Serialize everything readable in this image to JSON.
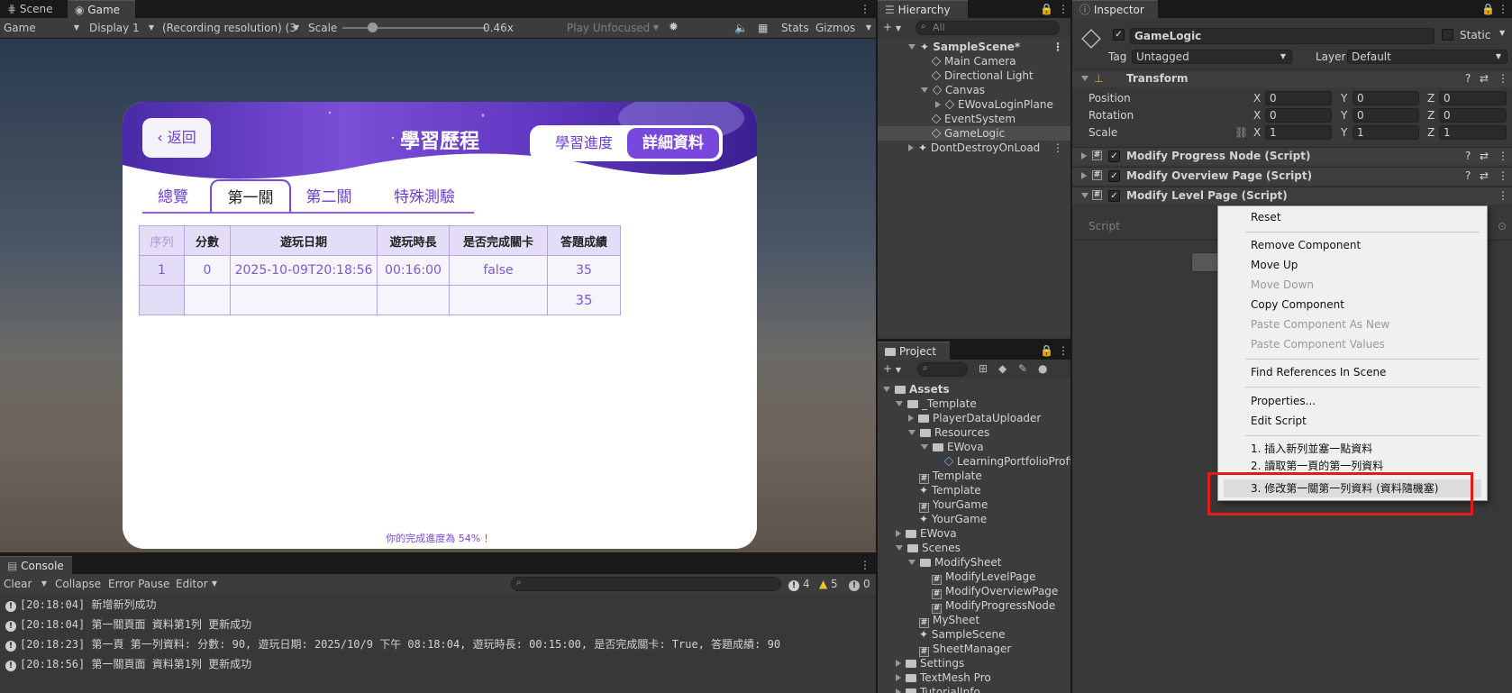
{
  "scene_panel": {
    "tabs": [
      {
        "label": "Scene"
      },
      {
        "label": "Game"
      }
    ],
    "toolbar": {
      "view_mode": "Game",
      "display": "Display 1",
      "resolution": "(Recording resolution) (3",
      "scale_label": "Scale",
      "scale_value": "0.46x",
      "play_mode": "Play Unfocused",
      "stats": "Stats",
      "gizmos": "Gizmos"
    }
  },
  "game": {
    "back_label": "返回",
    "title": "學習歷程",
    "segments": [
      "學習進度",
      "詳細資料"
    ],
    "level_tabs": [
      "總覽",
      "第一關",
      "第二關",
      "特殊測驗"
    ],
    "table": {
      "headers": [
        "序列",
        "分數",
        "遊玩日期",
        "遊玩時長",
        "是否完成關卡",
        "答題成績"
      ],
      "rows": [
        [
          "1",
          "0",
          "2025-10-09T20:18:56",
          "00:16:00",
          "false",
          "35"
        ],
        [
          "",
          "",
          "",
          "",
          "",
          "35"
        ]
      ]
    },
    "progress_note": "你的完成進度為 54% ！"
  },
  "hierarchy": {
    "tab": "Hierarchy",
    "search_placeholder": "All",
    "items": [
      {
        "label": "SampleScene*"
      },
      {
        "label": "Main Camera"
      },
      {
        "label": "Directional Light"
      },
      {
        "label": "Canvas"
      },
      {
        "label": "EWovaLoginPlane"
      },
      {
        "label": "EventSystem"
      },
      {
        "label": "GameLogic"
      },
      {
        "label": "DontDestroyOnLoad"
      }
    ]
  },
  "project": {
    "tab": "Project",
    "items": [
      {
        "label": "Assets"
      },
      {
        "label": "_Template"
      },
      {
        "label": "PlayerDataUploader"
      },
      {
        "label": "Resources"
      },
      {
        "label": "EWova"
      },
      {
        "label": "LearningPortfolioProfi"
      },
      {
        "label": "Template"
      },
      {
        "label": "Template"
      },
      {
        "label": "YourGame"
      },
      {
        "label": "YourGame"
      },
      {
        "label": "EWova"
      },
      {
        "label": "Scenes"
      },
      {
        "label": "ModifySheet"
      },
      {
        "label": "ModifyLevelPage"
      },
      {
        "label": "ModifyOverviewPage"
      },
      {
        "label": "ModifyProgressNode"
      },
      {
        "label": "MySheet"
      },
      {
        "label": "SampleScene"
      },
      {
        "label": "SheetManager"
      },
      {
        "label": "Settings"
      },
      {
        "label": "TextMesh Pro"
      },
      {
        "label": "TutorialInfo"
      }
    ]
  },
  "inspector": {
    "tab": "Inspector",
    "object_name": "GameLogic",
    "static_label": "Static",
    "tag_label": "Tag",
    "tag_value": "Untagged",
    "layer_label": "Layer",
    "layer_value": "Default",
    "transform": {
      "title": "Transform",
      "position_label": "Position",
      "rotation_label": "Rotation",
      "scale_label": "Scale",
      "position": [
        "0",
        "0",
        "0"
      ],
      "rotation": [
        "0",
        "0",
        "0"
      ],
      "scale": [
        "1",
        "1",
        "1"
      ],
      "axis_x": "X",
      "axis_y": "Y",
      "axis_z": "Z"
    },
    "components": [
      {
        "label": "Modify Progress Node (Script)"
      },
      {
        "label": "Modify Overview Page (Script)"
      },
      {
        "label": "Modify Level Page (Script)"
      }
    ],
    "script_label": "Script"
  },
  "context_menu": {
    "items": [
      {
        "label": "Reset",
        "enabled": true
      },
      {
        "label": "Remove Component",
        "enabled": true
      },
      {
        "label": "Move Up",
        "enabled": true
      },
      {
        "label": "Move Down",
        "enabled": false
      },
      {
        "label": "Copy Component",
        "enabled": true
      },
      {
        "label": "Paste Component As New",
        "enabled": false
      },
      {
        "label": "Paste Component Values",
        "enabled": false
      },
      {
        "label": "Find References In Scene",
        "enabled": true
      },
      {
        "label": "Properties...",
        "enabled": true
      },
      {
        "label": "Edit Script",
        "enabled": true
      },
      {
        "label": "1. 插入新列並塞一點資料",
        "enabled": true
      },
      {
        "label": "2. 讀取第一頁的第一列資料",
        "enabled": true
      },
      {
        "label": "3. 修改第一關第一列資料 (資料隨機塞)",
        "enabled": true
      }
    ]
  },
  "console": {
    "tab": "Console",
    "toolbar": {
      "clear": "Clear",
      "collapse": "Collapse",
      "error_pause": "Error Pause",
      "editor": "Editor",
      "info_count": "4",
      "warning_count": "5",
      "error_count": "0"
    },
    "lines": [
      {
        "text": "[20:18:04] 新增新列成功"
      },
      {
        "text": "[20:18:04] 第一關頁面 資料第1列 更新成功"
      },
      {
        "text": "[20:18:23] 第一頁 第一列資料: 分數: 90, 遊玩日期: 2025/10/9 下午 08:18:04, 遊玩時長: 00:15:00, 是否完成關卡: True, 答題成績: 90"
      },
      {
        "text": "[20:18:56] 第一關頁面 資料第1列 更新成功"
      }
    ]
  },
  "colors": {
    "accent_purple": "#7a47dd",
    "highlight_red": "#e01b1b",
    "editor_bg": "#383838"
  }
}
